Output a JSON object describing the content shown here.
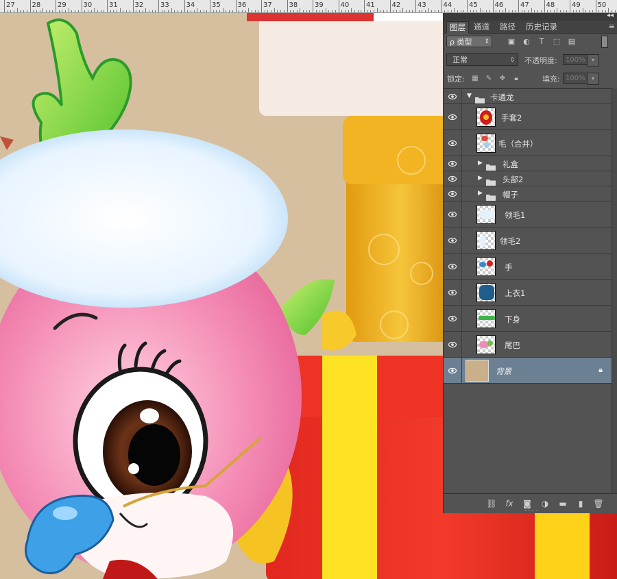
{
  "ruler": {
    "labels": [
      "27",
      "28",
      "29",
      "30",
      "31",
      "32",
      "33",
      "34",
      "35",
      "36",
      "37",
      "38",
      "39",
      "40",
      "41",
      "42",
      "43",
      "44",
      "45",
      "46",
      "47",
      "48",
      "49",
      "50"
    ]
  },
  "panel": {
    "tabs": [
      {
        "label": "图层",
        "active": true
      },
      {
        "label": "通道",
        "active": false
      },
      {
        "label": "路径",
        "active": false
      },
      {
        "label": "历史记录",
        "active": false
      }
    ],
    "filter": {
      "kind_label": "ρ 类型"
    },
    "blend_mode": "正常",
    "opacity_label": "不透明度:",
    "opacity_value": "100%",
    "lock_label": "锁定:",
    "fill_label": "填充:",
    "fill_value": "100%",
    "layers": [
      {
        "name": "卡通龙",
        "type": "group",
        "expanded": true
      },
      {
        "name": "手套2",
        "type": "pixel"
      },
      {
        "name": "毛（合并）",
        "type": "pixel"
      },
      {
        "name": "礼盒",
        "type": "group"
      },
      {
        "name": "头部2",
        "type": "group"
      },
      {
        "name": "帽子",
        "type": "group"
      },
      {
        "name": "领毛1",
        "type": "pixel"
      },
      {
        "name": "领毛2",
        "type": "pixel"
      },
      {
        "name": "手",
        "type": "pixel"
      },
      {
        "name": "上衣1",
        "type": "pixel"
      },
      {
        "name": "下身",
        "type": "pixel"
      },
      {
        "name": "尾巴",
        "type": "pixel"
      },
      {
        "name": "背景",
        "type": "background",
        "selected": true,
        "locked": true
      }
    ]
  },
  "colors": {
    "canvas_bg": "#d8c0a0",
    "panel_bg": "#535353",
    "selected_layer": "#6c8093"
  }
}
